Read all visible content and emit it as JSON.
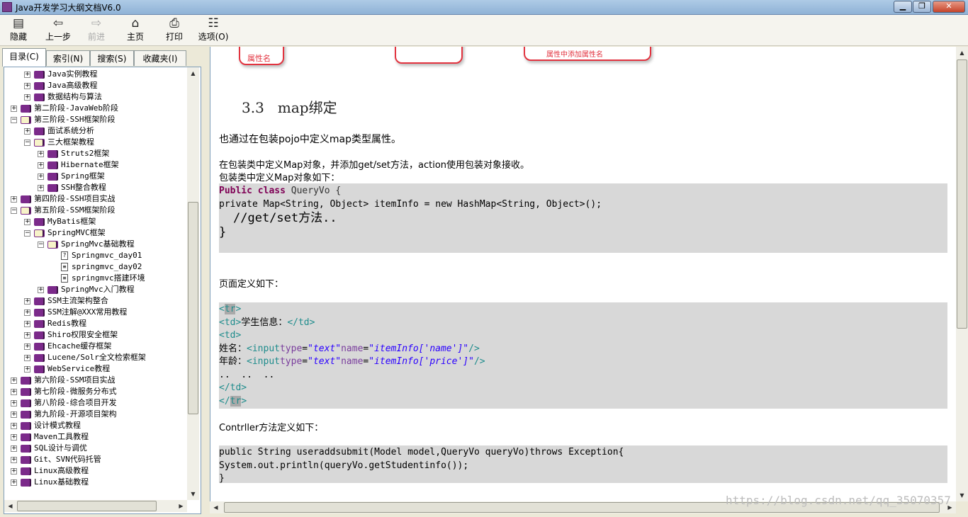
{
  "window": {
    "title": "Java开发学习大纲文档V6.0"
  },
  "toolbar": {
    "hide": "隐藏",
    "back": "上一步",
    "forward": "前进",
    "home": "主页",
    "print": "打印",
    "options": "选项(O)"
  },
  "tabs": [
    "目录(C)",
    "索引(N)",
    "搜索(S)",
    "收藏夹(I)"
  ],
  "tree": [
    {
      "label": "Java实例教程",
      "level": 1,
      "exp": "+",
      "icon": "book"
    },
    {
      "label": "Java高级教程",
      "level": 1,
      "exp": "+",
      "icon": "book"
    },
    {
      "label": "数据结构与算法",
      "level": 1,
      "exp": "+",
      "icon": "book"
    },
    {
      "label": "第二阶段-JavaWeb阶段",
      "level": 0,
      "exp": "+",
      "icon": "book"
    },
    {
      "label": "第三阶段-SSH框架阶段",
      "level": 0,
      "exp": "-",
      "icon": "open"
    },
    {
      "label": "面试系统分析",
      "level": 1,
      "exp": "+",
      "icon": "book"
    },
    {
      "label": "三大框架教程",
      "level": 1,
      "exp": "-",
      "icon": "open"
    },
    {
      "label": "Struts2框架",
      "level": 2,
      "exp": "+",
      "icon": "book"
    },
    {
      "label": "Hibernate框架",
      "level": 2,
      "exp": "+",
      "icon": "book"
    },
    {
      "label": "Spring框架",
      "level": 2,
      "exp": "+",
      "icon": "book"
    },
    {
      "label": "SSH整合教程",
      "level": 2,
      "exp": "+",
      "icon": "book"
    },
    {
      "label": "第四阶段-SSH项目实战",
      "level": 0,
      "exp": "+",
      "icon": "book"
    },
    {
      "label": "第五阶段-SSM框架阶段",
      "level": 0,
      "exp": "-",
      "icon": "open"
    },
    {
      "label": "MyBatis框架",
      "level": 1,
      "exp": "+",
      "icon": "book"
    },
    {
      "label": "SpringMVC框架",
      "level": 1,
      "exp": "-",
      "icon": "open"
    },
    {
      "label": "SpringMvc基础教程",
      "level": 2,
      "exp": "-",
      "icon": "open"
    },
    {
      "label": "Springmvc_day01",
      "level": 3,
      "exp": "",
      "icon": "help"
    },
    {
      "label": "springmvc_day02",
      "level": 3,
      "exp": "",
      "icon": "page"
    },
    {
      "label": "springmvc搭建环境",
      "level": 3,
      "exp": "",
      "icon": "page"
    },
    {
      "label": "SpringMvc入门教程",
      "level": 2,
      "exp": "+",
      "icon": "book"
    },
    {
      "label": "SSM主流架构整合",
      "level": 1,
      "exp": "+",
      "icon": "book"
    },
    {
      "label": "SSM注解@XXX常用教程",
      "level": 1,
      "exp": "+",
      "icon": "book"
    },
    {
      "label": "Redis教程",
      "level": 1,
      "exp": "+",
      "icon": "book"
    },
    {
      "label": "Shiro权限安全框架",
      "level": 1,
      "exp": "+",
      "icon": "book"
    },
    {
      "label": "Ehcache缓存框架",
      "level": 1,
      "exp": "+",
      "icon": "book"
    },
    {
      "label": "Lucene/Solr全文检索框架",
      "level": 1,
      "exp": "+",
      "icon": "book"
    },
    {
      "label": "WebService教程",
      "level": 1,
      "exp": "+",
      "icon": "book"
    },
    {
      "label": "第六阶段-SSM项目实战",
      "level": 0,
      "exp": "+",
      "icon": "book"
    },
    {
      "label": "第七阶段-微服务分布式",
      "level": 0,
      "exp": "+",
      "icon": "book"
    },
    {
      "label": "第八阶段-综合项目开发",
      "level": 0,
      "exp": "+",
      "icon": "book"
    },
    {
      "label": "第九阶段-开源项目架构",
      "level": 0,
      "exp": "+",
      "icon": "book"
    },
    {
      "label": "设计模式教程",
      "level": 0,
      "exp": "+",
      "icon": "book"
    },
    {
      "label": "Maven工具教程",
      "level": 0,
      "exp": "+",
      "icon": "book"
    },
    {
      "label": "SQL设计与调优",
      "level": 0,
      "exp": "+",
      "icon": "book"
    },
    {
      "label": "Git、SVN代码托管",
      "level": 0,
      "exp": "+",
      "icon": "book"
    },
    {
      "label": "Linux高级教程",
      "level": 0,
      "exp": "+",
      "icon": "book"
    },
    {
      "label": "Linux基础教程",
      "level": 0,
      "exp": "+",
      "icon": "book"
    }
  ],
  "content": {
    "diagram_label": "属性名",
    "diagram_text2": "属性中添加属性名",
    "heading_number": "3.3",
    "heading_title": "map绑定",
    "p1": "也通过在包装pojo中定义map类型属性。",
    "p2": "在包装类中定义Map对象，并添加get/set方法，action使用包装对象接收。",
    "p3": "包装类中定义Map对象如下：",
    "code1": {
      "kw_public": "Public",
      "kw_class": "class",
      "class_name": "QueryVo {",
      "line2": "private Map<String, Object> itemInfo = new HashMap<String, Object>();",
      "line3": "//get/set方法..",
      "line4": "}"
    },
    "p4": "页面定义如下：",
    "code2": {
      "tr": "tr",
      "td_label": "学生信息：",
      "name_label": "姓名：",
      "age_label": "年龄：",
      "input": "input",
      "type_attr": "type",
      "type_val": "\"text\"",
      "name_attr": "name",
      "name_val1": "\"itemInfo['name']\"",
      "name_val2": "\"itemInfo['price']\"",
      "dots": "..  ..  .."
    },
    "p5": "Contrller方法定义如下：",
    "code3": {
      "line1": "public String useraddsubmit(Model model,QueryVo queryVo)throws Exception{",
      "line2": "System.out.println(queryVo.getStudentinfo());",
      "line3": "}"
    }
  },
  "watermark": "https://blog.csdn.net/qq_35070357"
}
